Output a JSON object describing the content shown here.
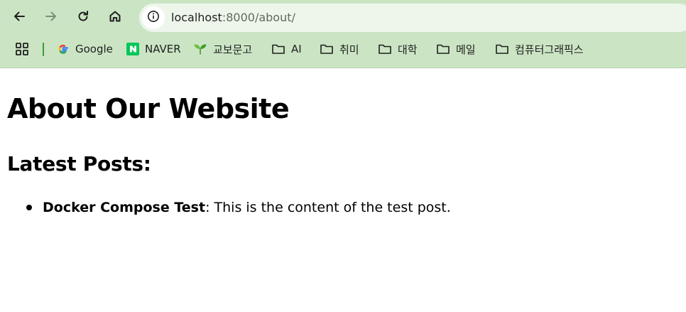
{
  "browser": {
    "nav": {
      "back_icon": "arrow-left-icon",
      "forward_icon": "arrow-right-icon",
      "reload_icon": "reload-icon",
      "home_icon": "home-icon"
    },
    "address_bar": {
      "site_info_icon": "info-icon",
      "url_host": "localhost",
      "url_path": ":8000/about/"
    },
    "bookmarks": {
      "apps_icon": "apps-grid-icon",
      "items": [
        {
          "label": "Google",
          "icon": "google-icon"
        },
        {
          "label": "NAVER",
          "icon": "naver-icon"
        },
        {
          "label": "교보문고",
          "icon": "kyobo-icon"
        },
        {
          "label": "AI",
          "icon": "folder-icon"
        },
        {
          "label": "취미",
          "icon": "folder-icon"
        },
        {
          "label": "대학",
          "icon": "folder-icon"
        },
        {
          "label": "메일",
          "icon": "folder-icon"
        },
        {
          "label": "컴퓨터그래픽스",
          "icon": "folder-icon"
        }
      ]
    },
    "colors": {
      "chrome_background": "#cbe5c4",
      "address_bar_background": "#eef6ec"
    }
  },
  "page": {
    "title": "About Our Website",
    "latest_posts_heading": "Latest Posts:",
    "posts": [
      {
        "title": "Docker Compose Test",
        "separator": ": ",
        "content": "This is the content of the test post."
      }
    ]
  }
}
